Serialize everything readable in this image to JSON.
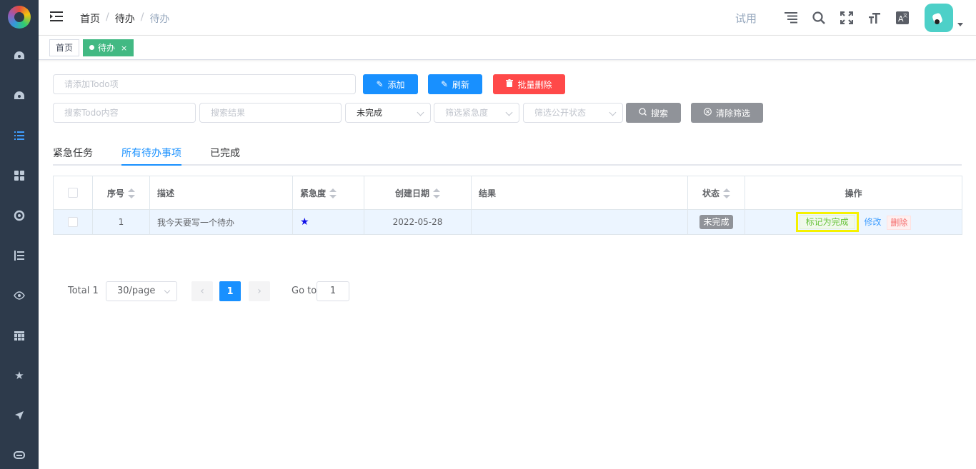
{
  "sidebar": {
    "items": [
      {
        "icon": "dashboard-icon"
      },
      {
        "icon": "dashboard-icon"
      },
      {
        "icon": "list-icon",
        "active": true
      },
      {
        "icon": "grid-icon"
      },
      {
        "icon": "target-icon"
      },
      {
        "icon": "tree-list-icon"
      },
      {
        "icon": "eye-icon"
      },
      {
        "icon": "table-icon"
      },
      {
        "icon": "star-icon"
      },
      {
        "icon": "send-icon"
      },
      {
        "icon": "chat-icon"
      }
    ]
  },
  "breadcrumb": {
    "home": "首页",
    "parent": "待办",
    "current": "待办"
  },
  "header": {
    "trial": "试用"
  },
  "tags": {
    "home": "首页",
    "active": "待办",
    "close": "×"
  },
  "toolbar": {
    "add_placeholder": "请添加Todo项",
    "add_label": "添加",
    "refresh_label": "刷新",
    "batch_delete_label": "批量删除"
  },
  "filters": {
    "search_content_placeholder": "搜索Todo内容",
    "search_result_placeholder": "搜索结果",
    "status_value": "未完成",
    "urgency_placeholder": "筛选紧急度",
    "public_placeholder": "筛选公开状态",
    "search_label": "搜索",
    "clear_label": "清除筛选"
  },
  "tabs": [
    "紧急任务",
    "所有待办事项",
    "已完成"
  ],
  "table": {
    "headers": {
      "index": "序号",
      "description": "描述",
      "urgency": "紧急度",
      "created": "创建日期",
      "result": "结果",
      "status": "状态",
      "actions": "操作"
    },
    "rows": [
      {
        "index": "1",
        "description": "我今天要写一个待办",
        "urgency_stars": 1,
        "created": "2022-05-28",
        "result": "",
        "status": "未完成",
        "mark_done": "标记为完成",
        "edit": "修改",
        "delete": "删除"
      }
    ]
  },
  "pagination": {
    "total": "Total 1",
    "page_size": "30/page",
    "current": "1",
    "goto_label": "Go to",
    "goto_value": "1"
  },
  "colors": {
    "primary": "#1890ff",
    "danger": "#ff4949",
    "success": "#42b983",
    "sidebar": "#2d3a4b",
    "highlight": "#f5f100"
  }
}
